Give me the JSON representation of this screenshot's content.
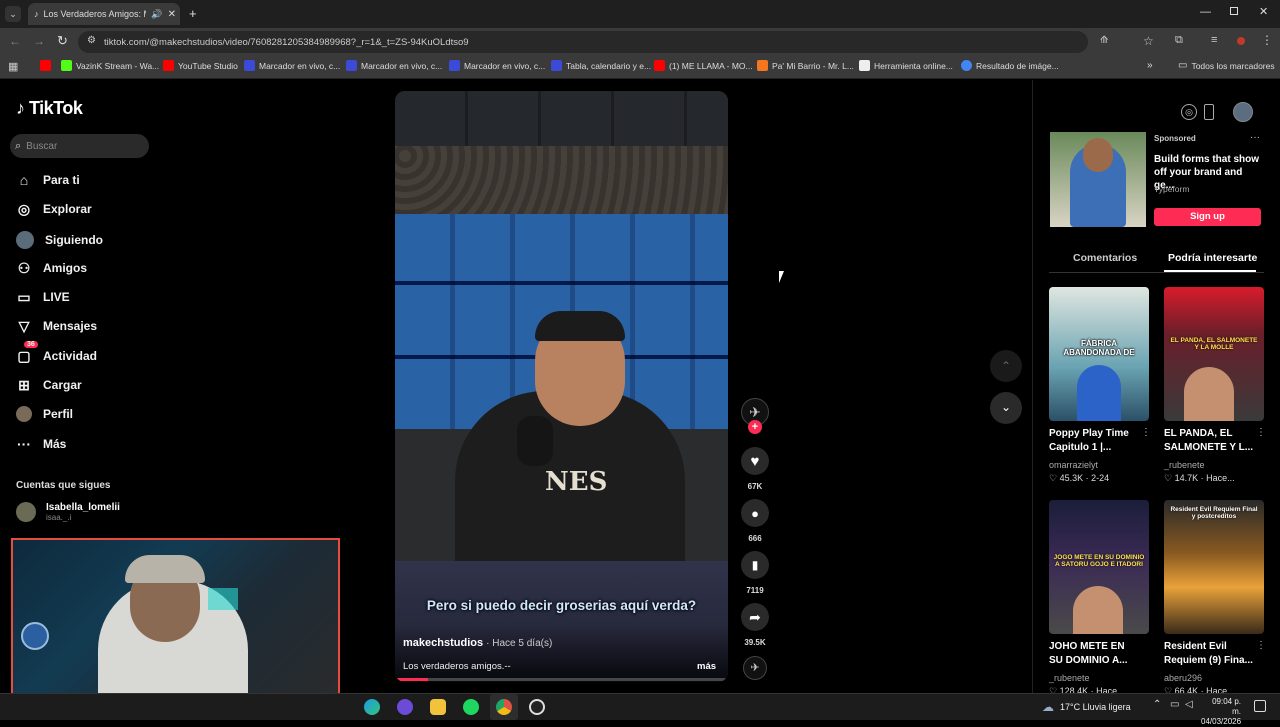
{
  "browser": {
    "tab_title": "Los Verdaderos Amigos: M",
    "url": "tiktok.com/@makechstudios/video/7608281205384989968?_r=1&_t=ZS-94KuOLdtso9",
    "bookmarks": [
      {
        "label": "VazinK Stream - Wa...",
        "color": "#53fc18"
      },
      {
        "label": "YouTube Studio",
        "color": "#ff0000"
      },
      {
        "label": "Marcador en vivo, c...",
        "color": "#3b4bd8"
      },
      {
        "label": "Marcador en vivo, c...",
        "color": "#3b4bd8"
      },
      {
        "label": "Marcador en vivo, c...",
        "color": "#3b4bd8"
      },
      {
        "label": "Tabla, calendario y e...",
        "color": "#3b4bd8"
      },
      {
        "label": "(1) ME LLAMA - MO...",
        "color": "#ff0000"
      },
      {
        "label": "Pa' Mi Barrio - Mr. L...",
        "color": "#f4761f"
      },
      {
        "label": "Herramienta online...",
        "color": "#eeeeee"
      },
      {
        "label": "Resultado de imáge...",
        "color": "#4285f4"
      }
    ],
    "all_bookmarks": "Todos los marcadores"
  },
  "tiktok": {
    "logo": "TikTok",
    "search_placeholder": "Buscar",
    "nav": [
      {
        "label": "Para ti",
        "icon": "home-icon"
      },
      {
        "label": "Explorar",
        "icon": "compass-icon"
      },
      {
        "label": "Siguiendo",
        "icon": "following-avatar-icon"
      },
      {
        "label": "Amigos",
        "icon": "friends-icon"
      },
      {
        "label": "LIVE",
        "icon": "live-icon"
      },
      {
        "label": "Mensajes",
        "icon": "messages-icon"
      },
      {
        "label": "Actividad",
        "icon": "activity-icon"
      },
      {
        "label": "Cargar",
        "icon": "upload-icon"
      },
      {
        "label": "Perfil",
        "icon": "profile-icon"
      },
      {
        "label": "Más",
        "icon": "more-icon"
      }
    ],
    "activity_badge": "36",
    "following_header": "Cuentas que sigues",
    "following": [
      {
        "name": "Isabella_lomelii",
        "handle": "isaa._.i"
      }
    ],
    "video": {
      "caption_overlay": "Pero si puedo decir groserias aquí verda?",
      "author": "makechstudios",
      "time": "· Hace 5 día(s)",
      "description": "Los verdaderos amigos.--",
      "more": "más",
      "progress": 0.1
    },
    "actions": {
      "likes": "67K",
      "comments": "666",
      "saves": "7119",
      "shares": "39.5K"
    },
    "ad": {
      "sponsored": "Sponsored",
      "text": "Build forms that show off your brand and ge...",
      "brand": "Typeform",
      "cta": "Sign up"
    },
    "tabs": [
      {
        "label": "Comentarios",
        "active": false
      },
      {
        "label": "Podría interesarte",
        "active": true
      }
    ],
    "recommendations": [
      {
        "title": "Poppy Play Time Capitulo 1 |...",
        "author": "omarrazielyt",
        "stats": "♡ 45.3K · 2-24",
        "thumb_text": "FÁBRICA ABANDONADA DE"
      },
      {
        "title": "EL PANDA, EL SALMONETE Y L...",
        "author": "_rubenete",
        "stats": "♡ 14.7K · Hace...",
        "thumb_text": "EL PANDA, EL SALMONETE Y LA MOLLE"
      },
      {
        "title": "JOHO METE EN SU DOMINIO A...",
        "author": "_rubenete",
        "stats": "♡ 128.4K · Hace...",
        "thumb_text": "JOGO METE EN SU DOMINIO A SATORU GOJO E ITADORI"
      },
      {
        "title": "Resident Evil Requiem (9) Fina...",
        "author": "aberu296",
        "stats": "♡ 66.4K · Hace...",
        "thumb_text": "Resident Evil Requiem Final y postcreditos"
      }
    ]
  },
  "taskbar": {
    "weather": "17°C  Lluvia ligera",
    "time": "09:04 p. m.",
    "date": "04/03/2026"
  }
}
